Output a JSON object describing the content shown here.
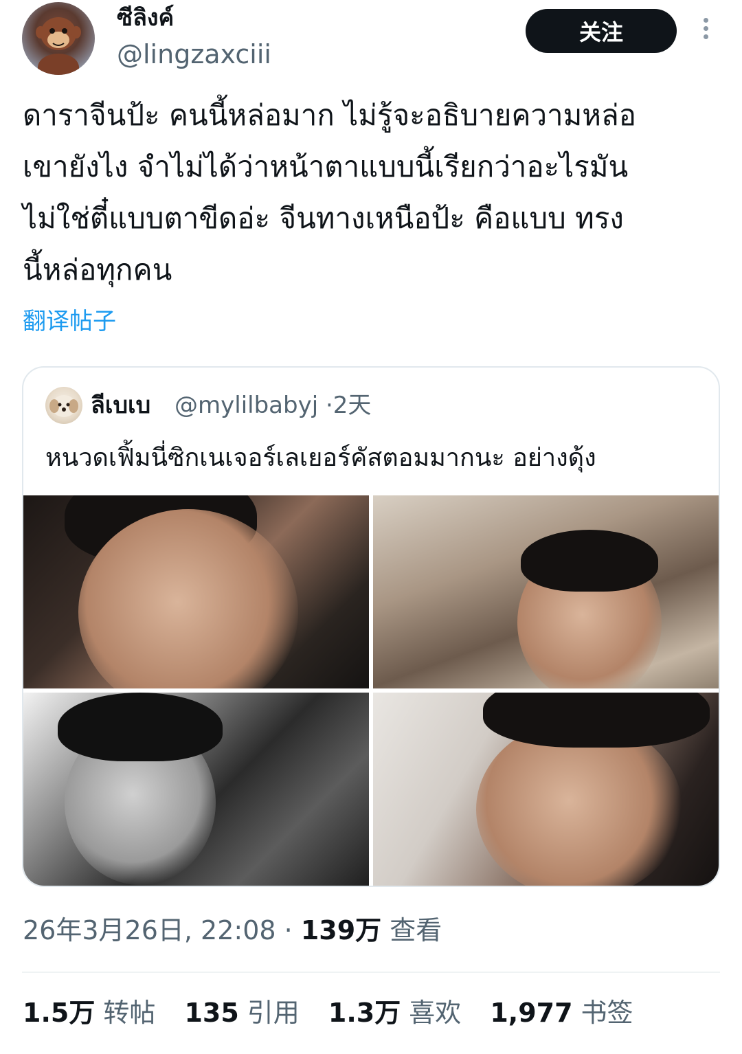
{
  "author": {
    "display_name": "ซีลิงค์",
    "handle": "@lingzaxciii"
  },
  "actions": {
    "follow_label": "关注",
    "more_icon": "more-vertical-icon"
  },
  "tweet": {
    "text": "ดาราจีนป้ะ คนนี้หล่อมาก ไม่รู้จะอธิบายความหล่อ\nเขายังไง จำไม่ได้ว่าหน้าตาแบบนี้เรียกว่าอะไรมัน\nไม่ใช่ตี๋แบบตาขีดอ่ะ จีนทางเหนือป้ะ คือแบบ ทรง\nนี้หล่อทุกคน",
    "translate_label": "翻译帖子"
  },
  "quote": {
    "display_name": "ลีเบเบ",
    "handle": "@mylilbabyj",
    "separator": "·",
    "age": "2天",
    "text": "หนวดเฟิ้มนี่ซิกเนเจอร์เลเยอร์คัสตอมมากนะ อย่างดุ้ง",
    "photo_count": 4
  },
  "meta": {
    "timestamp": "26年3月26日, 22:08",
    "separator": "·",
    "views_count": "139万",
    "views_label": "查看"
  },
  "stats": [
    {
      "count": "1.5万",
      "label": "转帖"
    },
    {
      "count": "135",
      "label": "引用"
    },
    {
      "count": "1.3万",
      "label": "喜欢"
    },
    {
      "count": "1,977",
      "label": "书签"
    }
  ],
  "colors": {
    "text": "#0f1419",
    "secondary": "#536471",
    "link": "#1d9bf0",
    "button": "#0f1419",
    "border": "#e1e8ed"
  }
}
